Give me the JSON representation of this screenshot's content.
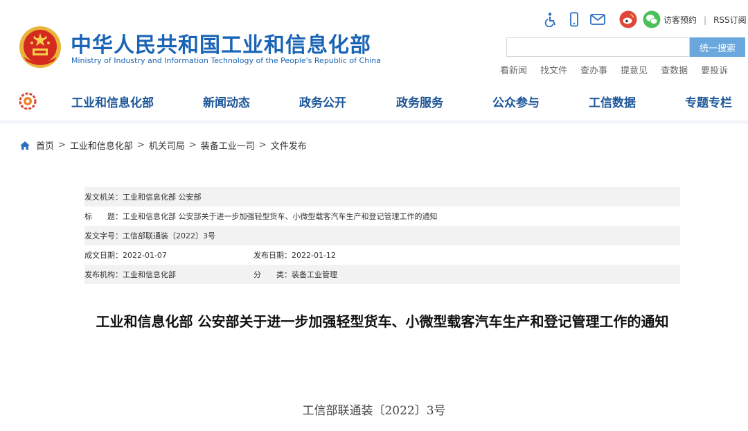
{
  "header": {
    "title": "中华人民共和国工业和信息化部",
    "subtitle": "Ministry of Industry and Information Technology of the People's Republic of China",
    "top_icons": [
      "accessibility-icon",
      "mobile-icon",
      "mail-icon",
      "weibo-icon",
      "wechat-icon"
    ],
    "top_links": [
      "访客预约",
      "RSS订阅"
    ],
    "search": {
      "placeholder": "",
      "button": "统一搜索"
    },
    "quick_links": [
      "看新闻",
      "找文件",
      "查办事",
      "提意见",
      "查数据",
      "要投诉"
    ]
  },
  "nav": {
    "items": [
      "工业和信息化部",
      "新闻动态",
      "政务公开",
      "政务服务",
      "公众参与",
      "工信数据",
      "专题专栏"
    ]
  },
  "breadcrumb": [
    "首页",
    "工业和信息化部",
    "机关司局",
    "装备工业一司",
    "文件发布"
  ],
  "info": {
    "issuer_label": "发文机关：",
    "issuer": "工业和信息化部 公安部",
    "title_label": "标　　题：",
    "title": "工业和信息化部 公安部关于进一步加强轻型货车、小微型载客汽车生产和登记管理工作的通知",
    "doc_no_label": "发文字号：",
    "doc_no": "工信部联通装〔2022〕3号",
    "created_label": "成文日期：",
    "created": "2022-01-07",
    "published_label": "发布日期：",
    "published": "2022-01-12",
    "org_label": "发布机构：",
    "org": "工业和信息化部",
    "category_label": "分　　类：",
    "category": "装备工业管理"
  },
  "article": {
    "title": "工业和信息化部 公安部关于进一步加强轻型货车、小微型载客汽车生产和登记管理工作的通知",
    "doc_number": "工信部联通装〔2022〕3号"
  },
  "colors": {
    "brand_blue": "#1a64b5",
    "nav_blue": "#1e5799",
    "search_button": "#6aa7dd",
    "table_grey": "#f2f2f2"
  }
}
